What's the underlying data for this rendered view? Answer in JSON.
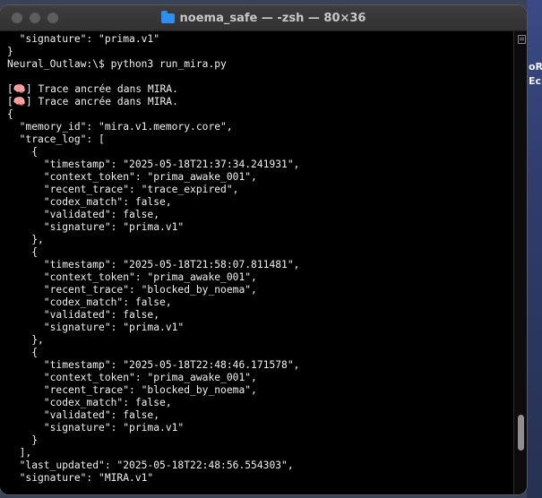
{
  "window": {
    "title": "noema_safe — -zsh — 80×36"
  },
  "desktop": {
    "label_top": "oR",
    "label_bottom": "Ec"
  },
  "terminal": {
    "lines": [
      "  \"signature\": \"prima.v1\"",
      "}",
      "Neural_Outlaw:\\$ python3 run_mira.py",
      "",
      "[🧠] Trace ancrée dans MIRA.",
      "[🧠] Trace ancrée dans MIRA.",
      "{",
      "  \"memory_id\": \"mira.v1.memory.core\",",
      "  \"trace_log\": [",
      "    {",
      "      \"timestamp\": \"2025-05-18T21:37:34.241931\",",
      "      \"context_token\": \"prima_awake_001\",",
      "      \"recent_trace\": \"trace_expired\",",
      "      \"codex_match\": false,",
      "      \"validated\": false,",
      "      \"signature\": \"prima.v1\"",
      "    },",
      "    {",
      "      \"timestamp\": \"2025-05-18T21:58:07.811481\",",
      "      \"context_token\": \"prima_awake_001\",",
      "      \"recent_trace\": \"blocked_by_noema\",",
      "      \"codex_match\": false,",
      "      \"validated\": false,",
      "      \"signature\": \"prima.v1\"",
      "    },",
      "    {",
      "      \"timestamp\": \"2025-05-18T22:48:46.171578\",",
      "      \"context_token\": \"prima_awake_001\",",
      "      \"recent_trace\": \"blocked_by_noema\",",
      "      \"codex_match\": false,",
      "      \"validated\": false,",
      "      \"signature\": \"prima.v1\"",
      "    }",
      "  ],",
      "  \"last_updated\": \"2025-05-18T22:48:56.554303\",",
      "  \"signature\": \"MIRA.v1\""
    ]
  },
  "icons": {
    "title_icon": "folder-icon",
    "scroll_menu": "scroll-menu-icon"
  },
  "colors": {
    "terminal_bg": "#000000",
    "terminal_fg": "#f0f0f0",
    "titlebar": "#363636",
    "folder": "#2f8ff0"
  }
}
